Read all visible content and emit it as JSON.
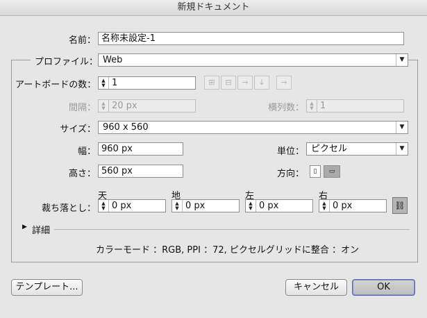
{
  "window": {
    "title": "新規ドキュメント"
  },
  "name": {
    "label": "名前：",
    "value": "名称未設定-1"
  },
  "profile": {
    "label": "プロファイル：",
    "value": "Web"
  },
  "artboards": {
    "count_label": "アートボードの数：",
    "count_value": "1",
    "spacing_label": "間隔：",
    "spacing_value": "20 px",
    "columns_label": "横列数：",
    "columns_value": "1",
    "layout_icons": [
      "grid-by-row-icon",
      "grid-by-column-icon",
      "arrange-by-row-icon",
      "arrange-by-column-icon",
      "right-to-left-icon"
    ]
  },
  "size": {
    "label": "サイズ：",
    "value": "960 x 560"
  },
  "width": {
    "label": "幅：",
    "value": "960 px"
  },
  "height": {
    "label": "高さ：",
    "value": "560 px"
  },
  "units": {
    "label": "単位：",
    "value": "ピクセル"
  },
  "orientation": {
    "label": "方向：",
    "selected": "landscape"
  },
  "bleed": {
    "label": "裁ち落とし：",
    "top_label": "天",
    "top_value": "0 px",
    "bottom_label": "地",
    "bottom_value": "0 px",
    "left_label": "左",
    "left_value": "0 px",
    "right_label": "右",
    "right_value": "0 px"
  },
  "advanced": {
    "label": "詳細"
  },
  "summary": {
    "text": "カラーモード ：RGB, PPI ：72, ピクセルグリッドに整合 ：オン"
  },
  "buttons": {
    "templates": "テンプレート...",
    "cancel": "キャンセル",
    "ok": "OK"
  }
}
